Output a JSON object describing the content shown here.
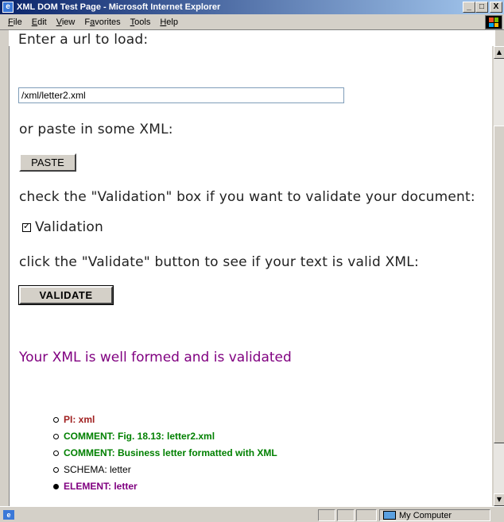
{
  "window": {
    "title": "XML DOM Test Page - Microsoft Internet Explorer",
    "buttons": {
      "minimize": "_",
      "maximize": "□",
      "close": "X"
    }
  },
  "menu": [
    {
      "label": "File",
      "accel": "F",
      "rest": "ile"
    },
    {
      "label": "Edit",
      "accel": "E",
      "rest": "dit"
    },
    {
      "label": "View",
      "accel": "V",
      "rest": "iew"
    },
    {
      "label": "Favorites",
      "accel": "a",
      "pre": "F",
      "rest": "vorites"
    },
    {
      "label": "Tools",
      "accel": "T",
      "rest": "ools"
    },
    {
      "label": "Help",
      "accel": "H",
      "rest": "elp"
    }
  ],
  "page": {
    "url_prompt": "Enter a url to load:",
    "url_value": "/xml/letter2.xml",
    "paste_prompt": "or paste in some XML:",
    "paste_button": "PASTE",
    "validation_prompt": "check the \"Validation\" box if you want to validate your document:",
    "validation_label": "Validation",
    "validation_checked": true,
    "validate_prompt": "click the \"Validate\" button to see if your text is valid XML:",
    "validate_button": "VALIDATE",
    "result_message": "Your XML is well formed and is validated",
    "result_color": "#800080"
  },
  "nodes": [
    {
      "text": "PI: xml",
      "color": "#a02020",
      "bold": true,
      "bullet": "hollow"
    },
    {
      "text": "COMMENT: Fig. 18.13: letter2.xml",
      "color": "#008000",
      "bold": true,
      "bullet": "hollow"
    },
    {
      "text": "COMMENT: Business letter formatted with XML",
      "color": "#008000",
      "bold": true,
      "bullet": "hollow"
    },
    {
      "text": "SCHEMA: letter",
      "color": "#000000",
      "bold": false,
      "bullet": "hollow"
    },
    {
      "text": "ELEMENT: letter",
      "color": "#800080",
      "bold": true,
      "bullet": "filled"
    }
  ],
  "statusbar": {
    "zone": "My Computer"
  },
  "icons": [
    "ie-page-icon",
    "windows-logo-icon",
    "computer-icon",
    "scroll-up-icon",
    "scroll-down-icon"
  ]
}
